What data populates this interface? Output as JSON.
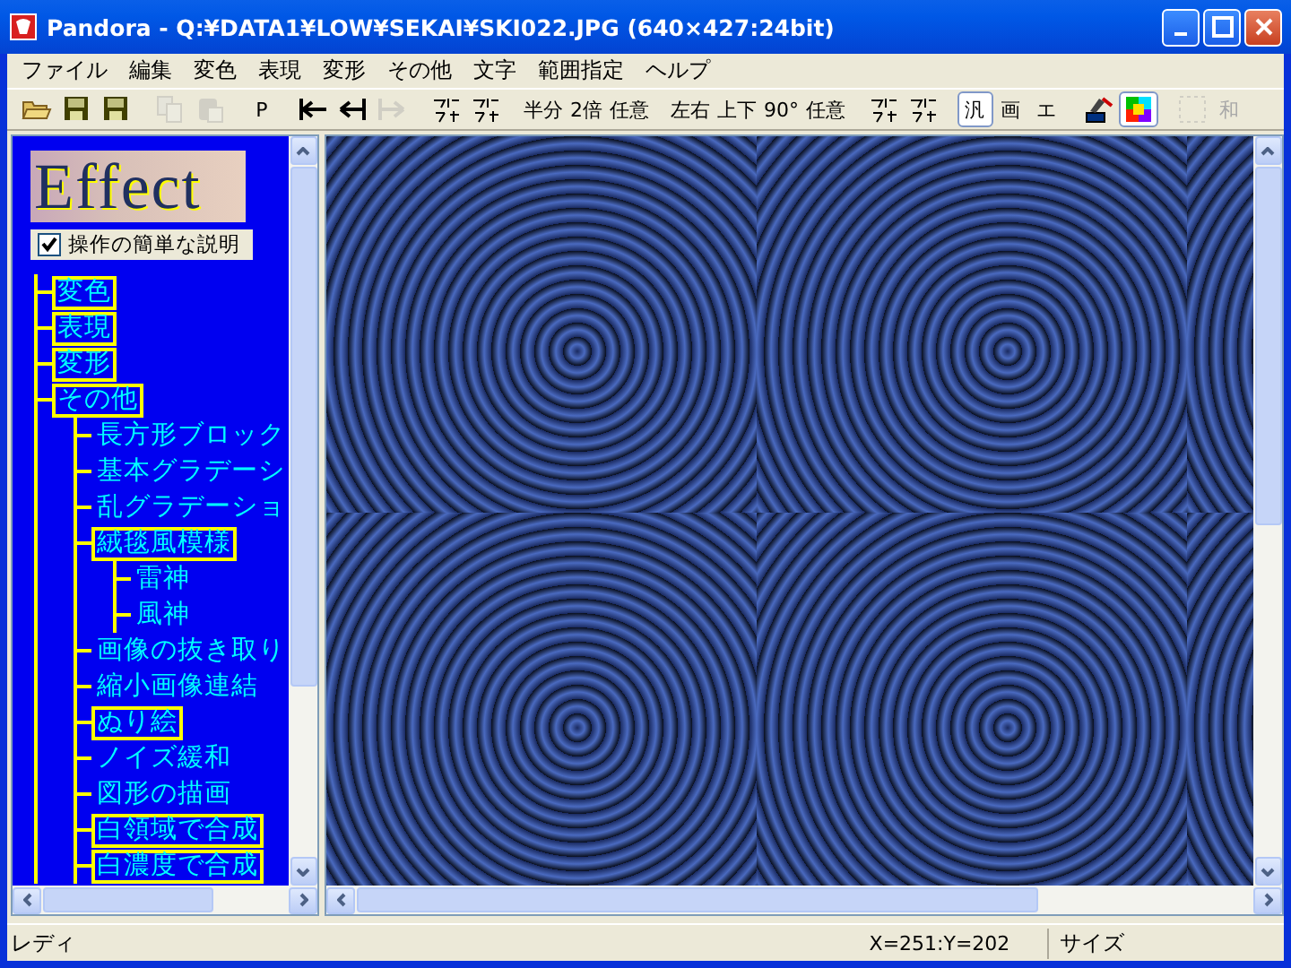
{
  "window": {
    "title": "Pandora - Q:¥DATA1¥LOW¥SEKAI¥SKI022.JPG  (640×427:24bit)"
  },
  "menu": [
    "ファイル",
    "編集",
    "変色",
    "表現",
    "変形",
    "その他",
    "文字",
    "範囲指定",
    "ヘルプ"
  ],
  "toolbar": [
    {
      "kind": "open",
      "disabled": false,
      "pressed": false
    },
    {
      "kind": "save",
      "disabled": false,
      "pressed": false
    },
    {
      "kind": "save",
      "disabled": false,
      "pressed": false
    },
    {
      "kind": "copy",
      "disabled": true,
      "pressed": false
    },
    {
      "kind": "paste",
      "disabled": true,
      "pressed": false
    },
    {
      "kind": "text",
      "label": "P",
      "disabled": false,
      "pressed": false
    },
    {
      "kind": "bar-left",
      "disabled": false,
      "pressed": false
    },
    {
      "kind": "bar-both",
      "disabled": false,
      "pressed": false
    },
    {
      "kind": "bar-right",
      "disabled": true,
      "pressed": false
    },
    {
      "kind": "glyph",
      "disabled": false,
      "pressed": false
    },
    {
      "kind": "glyph",
      "disabled": false,
      "pressed": false
    },
    {
      "kind": "text",
      "label": "半分",
      "disabled": false,
      "pressed": false
    },
    {
      "kind": "text",
      "label": "2倍",
      "disabled": false,
      "pressed": false
    },
    {
      "kind": "text",
      "label": "任意",
      "disabled": false,
      "pressed": false
    },
    {
      "kind": "text",
      "label": "左右",
      "disabled": false,
      "pressed": false
    },
    {
      "kind": "text",
      "label": "上下",
      "disabled": false,
      "pressed": false
    },
    {
      "kind": "text",
      "label": "90°",
      "disabled": false,
      "pressed": false
    },
    {
      "kind": "text",
      "label": "任意",
      "disabled": false,
      "pressed": false
    },
    {
      "kind": "glyph",
      "disabled": false,
      "pressed": false
    },
    {
      "kind": "glyph",
      "disabled": false,
      "pressed": false
    },
    {
      "kind": "text",
      "label": "汎",
      "disabled": false,
      "pressed": true
    },
    {
      "kind": "text",
      "label": "画",
      "disabled": false,
      "pressed": false
    },
    {
      "kind": "text",
      "label": "エ",
      "disabled": false,
      "pressed": false
    },
    {
      "kind": "pen",
      "disabled": false,
      "pressed": false
    },
    {
      "kind": "palette",
      "disabled": false,
      "pressed": true
    },
    {
      "kind": "selection",
      "disabled": true,
      "pressed": false
    },
    {
      "kind": "text",
      "label": "和",
      "disabled": true,
      "pressed": false
    }
  ],
  "sidebar": {
    "logo": "Effect",
    "help_checkbox": {
      "label": "操作の簡単な説明",
      "checked": true
    },
    "tree": [
      {
        "label": "変色",
        "boxed": true
      },
      {
        "label": "表現",
        "boxed": true
      },
      {
        "label": "変形",
        "boxed": true
      },
      {
        "label": "その他",
        "boxed": true,
        "children": [
          {
            "label": "長方形ブロック",
            "boxed": false
          },
          {
            "label": "基本グラデーシ",
            "boxed": false
          },
          {
            "label": "乱グラデーショ",
            "boxed": false
          },
          {
            "label": "絨毯風模様",
            "boxed": true,
            "children": [
              {
                "label": "雷神",
                "boxed": false
              },
              {
                "label": "風神",
                "boxed": false
              }
            ]
          },
          {
            "label": "画像の抜き取り",
            "boxed": false
          },
          {
            "label": "縮小画像連結",
            "boxed": false
          },
          {
            "label": "ぬり絵",
            "boxed": true
          },
          {
            "label": "ノイズ緩和",
            "boxed": false
          },
          {
            "label": "図形の描画",
            "boxed": false
          },
          {
            "label": "白領域で合成",
            "boxed": true
          },
          {
            "label": "白濃度で合成",
            "boxed": true
          }
        ]
      }
    ]
  },
  "status_bar": {
    "message": "レディ",
    "position": "X=251:Y=202",
    "size": "サイズ"
  }
}
